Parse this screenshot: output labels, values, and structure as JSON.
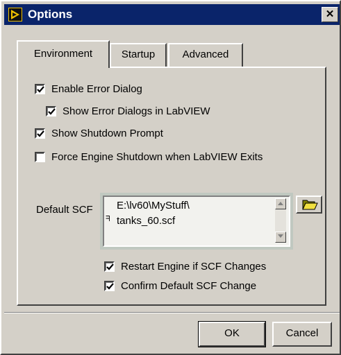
{
  "window": {
    "title": "Options",
    "close_glyph": "✕"
  },
  "tabs": [
    {
      "label": "Environment",
      "active": true
    },
    {
      "label": "Startup",
      "active": false
    },
    {
      "label": "Advanced",
      "active": false
    }
  ],
  "options": {
    "enable_error_dialog": {
      "label": "Enable Error Dialog",
      "checked": true
    },
    "show_error_dialogs": {
      "label": "Show Error Dialogs in LabVIEW",
      "checked": true
    },
    "show_shutdown_prompt": {
      "label": "Show Shutdown Prompt",
      "checked": true
    },
    "force_engine_shutdown": {
      "label": "Force Engine Shutdown when LabVIEW Exits",
      "checked": false
    }
  },
  "scf": {
    "label": "Default SCF",
    "path_line1": "E:\\lv60\\MyStuff\\",
    "path_line2": "tanks_60.scf",
    "marker": "ᖷ"
  },
  "scf_options": {
    "restart_engine": {
      "label": "Restart Engine if SCF Changes",
      "checked": true
    },
    "confirm_default": {
      "label": "Confirm Default SCF Change",
      "checked": true
    }
  },
  "buttons": {
    "ok": "OK",
    "cancel": "Cancel"
  },
  "icons": {
    "app": "labview-app-icon",
    "folder": "folder-open-icon",
    "close": "close-icon"
  },
  "colors": {
    "titlebar": "#0a246a",
    "face": "#d4d0c8"
  }
}
